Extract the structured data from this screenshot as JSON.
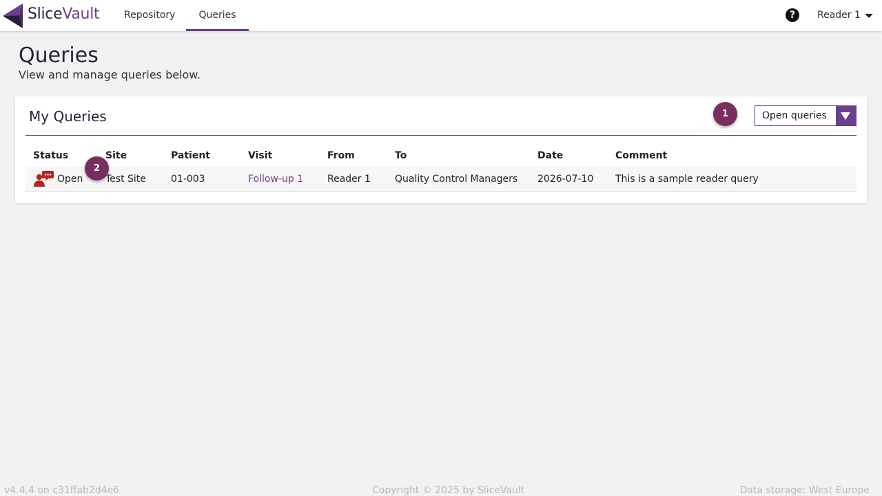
{
  "app": {
    "brand_slice": "Slice",
    "brand_vault": "Vault"
  },
  "nav": {
    "repository": "Repository",
    "queries": "Queries"
  },
  "help_icon": "?",
  "user": {
    "name": "Reader 1"
  },
  "page": {
    "title": "Queries",
    "subtitle": "View and manage queries below."
  },
  "card": {
    "title": "My Queries",
    "filter": {
      "selected": "Open queries"
    }
  },
  "badges": {
    "one": "1",
    "two": "2"
  },
  "table": {
    "headers": {
      "status": "Status",
      "site": "Site",
      "patient": "Patient",
      "visit": "Visit",
      "from": "From",
      "to": "To",
      "date": "Date",
      "comment": "Comment"
    },
    "rows": [
      {
        "status": "Open",
        "site": "Test Site",
        "patient": "01-003",
        "visit": "Follow-up 1",
        "from": "Reader 1",
        "to": "Quality Control Managers",
        "date": "2026-07-10",
        "comment": "This is a sample reader query"
      }
    ]
  },
  "footer": {
    "version": "v4.4.4 on c31ffab2d4e6",
    "copyright": "Copyright © 2025 by SliceVault",
    "storage": "Data storage: West Europe"
  },
  "colors": {
    "brand": "#6b3f8c",
    "badge": "#7a2d5f",
    "status_icon": "#b3261e"
  }
}
